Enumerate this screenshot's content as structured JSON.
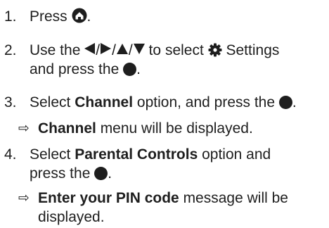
{
  "steps": [
    {
      "number": "1.",
      "parts": {
        "a": "Press",
        "b": "."
      },
      "icons": [
        "home-icon"
      ]
    },
    {
      "number": "2.",
      "parts": {
        "a": "Use the",
        "sep": "/",
        "b": "to select",
        "settings": "Settings",
        "c": "and press the",
        "d": "."
      },
      "icons": [
        "arrow-left-icon",
        "arrow-right-icon",
        "arrow-up-icon",
        "arrow-down-icon",
        "settings-gear-icon",
        "ok-button-icon"
      ]
    },
    {
      "number": "3.",
      "parts": {
        "a": "Select",
        "bold": "Channel",
        "b": "option, and press the",
        "c": "."
      },
      "icons": [
        "ok-button-icon"
      ]
    },
    {
      "result": true,
      "mark": "⇨",
      "parts": {
        "bold": "Channel",
        "a": "menu will be displayed."
      }
    },
    {
      "number": "4.",
      "parts": {
        "a": "Select",
        "bold": "Parental Controls",
        "b": "option and",
        "c": "press the",
        "d": "."
      },
      "icons": [
        "ok-button-icon"
      ]
    },
    {
      "result": true,
      "mark": "⇨",
      "parts": {
        "bold": "Enter your PIN code",
        "a": "message will be",
        "b": "displayed."
      }
    }
  ],
  "colors": {
    "text": "#1e1e1e",
    "background": "#ffffff"
  }
}
